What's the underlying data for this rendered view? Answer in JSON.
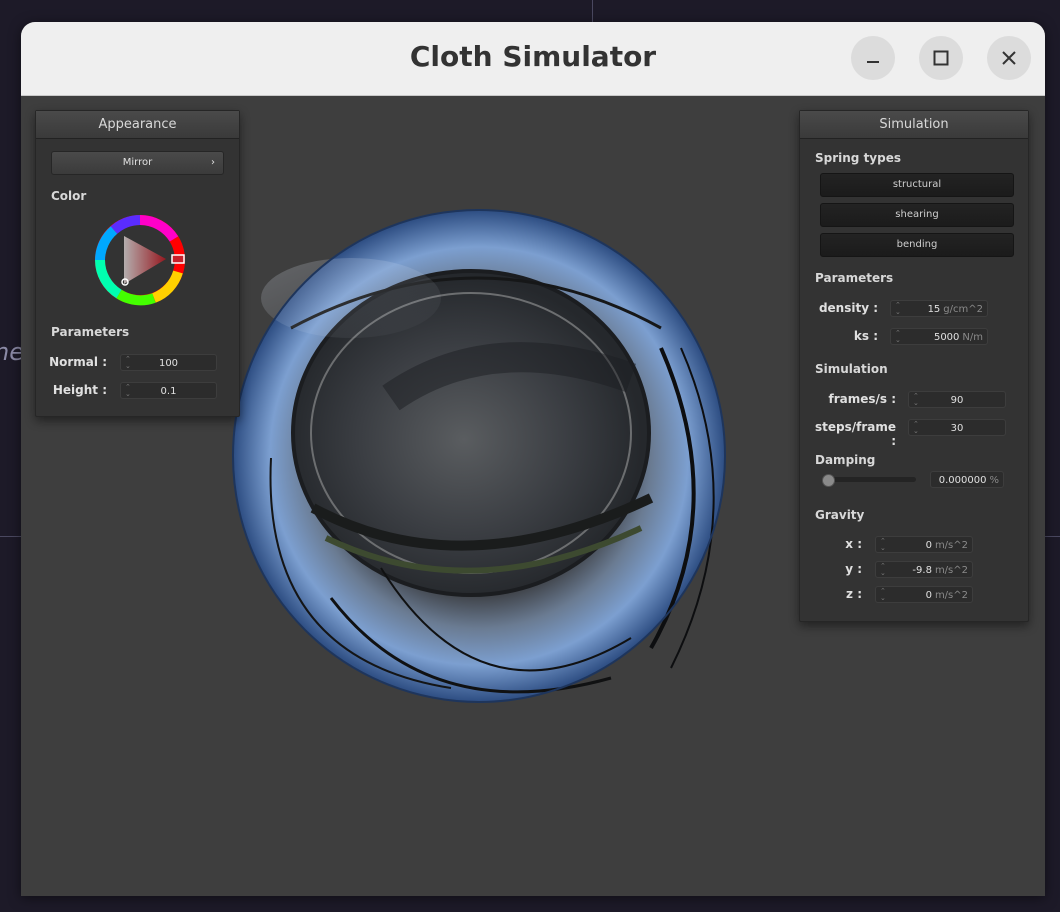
{
  "background": {
    "partial_text": "ne"
  },
  "window": {
    "title": "Cloth Simulator",
    "minimize_icon": "minimize-icon",
    "maximize_icon": "maximize-icon",
    "close_icon": "close-icon"
  },
  "appearance": {
    "header": "Appearance",
    "shader": "Mirror",
    "color_label": "Color",
    "selected_color": "#c8202a",
    "parameters_label": "Parameters",
    "normal_label": "Normal :",
    "normal_value": "100",
    "height_label": "Height :",
    "height_value": "0.1"
  },
  "simulation": {
    "header": "Simulation",
    "spring_types_label": "Spring types",
    "spring_structural": "structural",
    "spring_shearing": "shearing",
    "spring_bending": "bending",
    "parameters_label": "Parameters",
    "density_label": "density :",
    "density_value": "15",
    "density_unit": "g/cm^2",
    "ks_label": "ks :",
    "ks_value": "5000",
    "ks_unit": "N/m",
    "simulation_label": "Simulation",
    "fps_label": "frames/s :",
    "fps_value": "90",
    "steps_label": "steps/frame :",
    "steps_value": "30",
    "damping_label": "Damping",
    "damping_slider_value": 0,
    "damping_value": "0.000000",
    "damping_unit": "%",
    "gravity_label": "Gravity",
    "gx_label": "x :",
    "gx_value": "0",
    "gy_label": "y :",
    "gy_value": "-9.8",
    "gz_label": "z :",
    "gz_value": "0",
    "gravity_unit": "m/s^2"
  }
}
